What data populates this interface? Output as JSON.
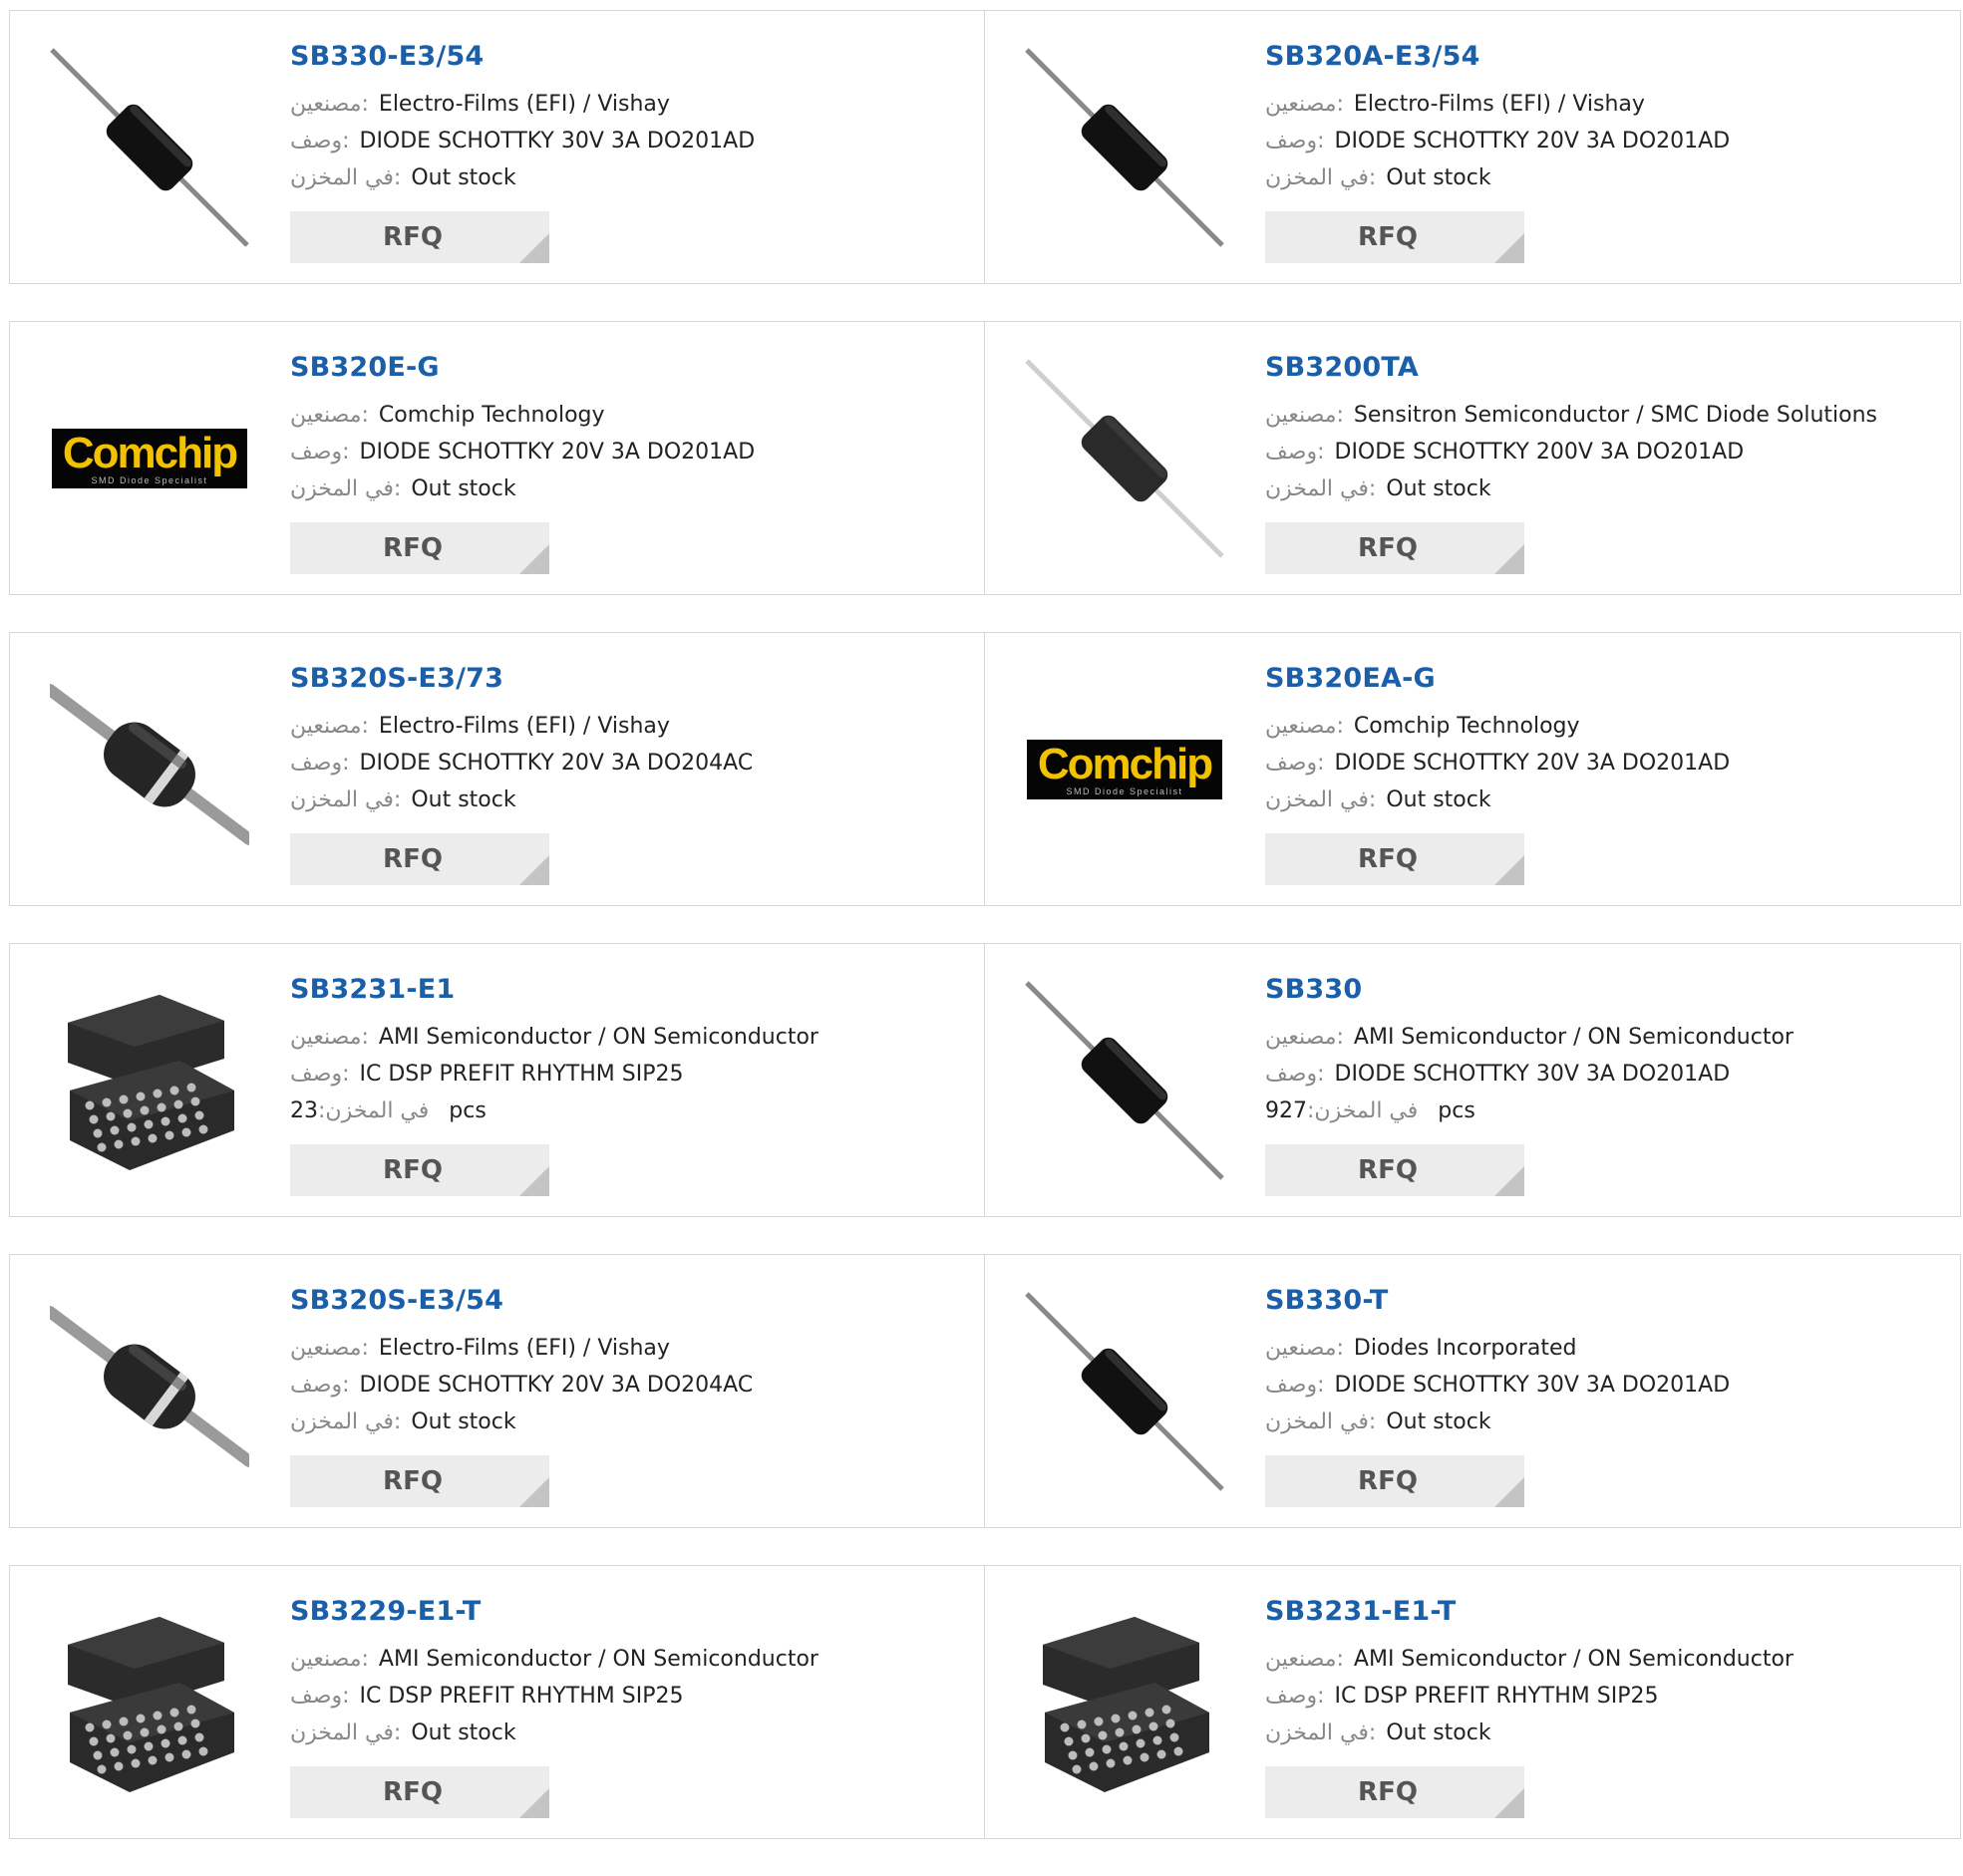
{
  "labels": {
    "manufacturer": "مصنعين:",
    "description": "وصف:",
    "stock": "في المخزن:",
    "rfq": "RFQ",
    "pcs": "pcs"
  },
  "products": [
    {
      "pn": "SB330-E3/54",
      "mfr": "Electro-Films (EFI) / Vishay",
      "desc": "DIODE SCHOTTKY 30V 3A DO201AD",
      "stock": "Out stock",
      "image": "axial-diode-icon"
    },
    {
      "pn": "SB320A-E3/54",
      "mfr": "Electro-Films (EFI) / Vishay",
      "desc": "DIODE SCHOTTKY 20V 3A DO201AD",
      "stock": "Out stock",
      "image": "axial-diode-icon"
    },
    {
      "pn": "SB320E-G",
      "mfr": "Comchip Technology",
      "desc": "DIODE SCHOTTKY 20V 3A DO201AD",
      "stock": "Out stock",
      "image": "comchip-logo"
    },
    {
      "pn": "SB3200TA",
      "mfr": "Sensitron Semiconductor / SMC Diode Solutions",
      "desc": "DIODE SCHOTTKY 200V 3A DO201AD",
      "stock": "Out stock",
      "image": "axial-diode-light-icon"
    },
    {
      "pn": "SB320S-E3/73",
      "mfr": "Electro-Films (EFI) / Vishay",
      "desc": "DIODE SCHOTTKY 20V 3A DO204AC",
      "stock": "Out stock",
      "image": "banded-diode-icon"
    },
    {
      "pn": "SB320EA-G",
      "mfr": "Comchip Technology",
      "desc": "DIODE SCHOTTKY 20V 3A DO201AD",
      "stock": "Out stock",
      "image": "comchip-logo"
    },
    {
      "pn": "SB3231-E1",
      "mfr": "AMI Semiconductor / ON Semiconductor",
      "desc": "IC DSP PREFIT RHYTHM SIP25",
      "stock": "23",
      "stock_unit": "pcs",
      "image": "sip-chip-icon"
    },
    {
      "pn": "SB330",
      "mfr": "AMI Semiconductor / ON Semiconductor",
      "desc": "DIODE SCHOTTKY 30V 3A DO201AD",
      "stock": "927",
      "stock_unit": "pcs",
      "image": "axial-diode-icon"
    },
    {
      "pn": "SB320S-E3/54",
      "mfr": "Electro-Films (EFI) / Vishay",
      "desc": "DIODE SCHOTTKY 20V 3A DO204AC",
      "stock": "Out stock",
      "image": "banded-diode-icon"
    },
    {
      "pn": "SB330-T",
      "mfr": "Diodes Incorporated",
      "desc": "DIODE SCHOTTKY 30V 3A DO201AD",
      "stock": "Out stock",
      "image": "axial-diode-icon"
    },
    {
      "pn": "SB3229-E1-T",
      "mfr": "AMI Semiconductor / ON Semiconductor",
      "desc": "IC DSP PREFIT RHYTHM SIP25",
      "stock": "Out stock",
      "image": "sip-chip-icon"
    },
    {
      "pn": "SB3231-E1-T",
      "mfr": "AMI Semiconductor / ON Semiconductor",
      "desc": "IC DSP PREFIT RHYTHM SIP25",
      "stock": "Out stock",
      "image": "sip-chip-icon"
    }
  ],
  "logo_text": {
    "brand": "Comchip",
    "tagline": "SMD Diode Specialist"
  },
  "colors": {
    "link": "#1b5fa8",
    "label": "#888888",
    "rfq_bg": "#ececec",
    "border": "#d7d7d7"
  }
}
